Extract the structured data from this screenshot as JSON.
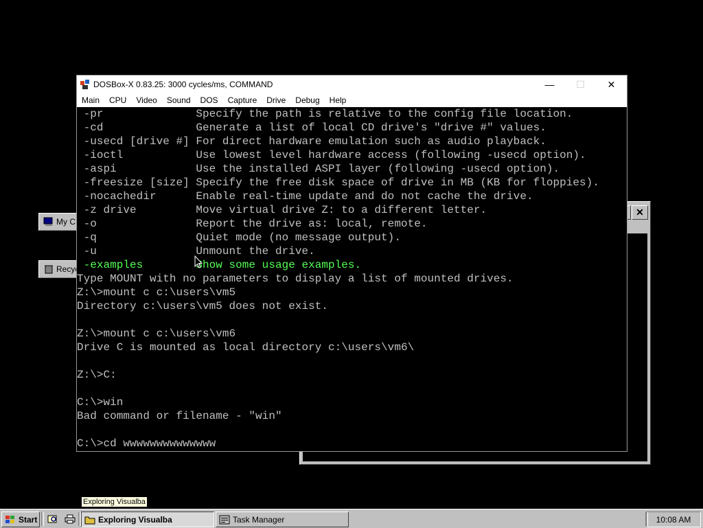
{
  "desktop": {
    "icons": [
      {
        "label": "My C"
      },
      {
        "label": "Recyc"
      }
    ]
  },
  "bg_window": {
    "close_glyph": "✕"
  },
  "dosbox": {
    "title": "DOSBox-X 0.83.25: 3000 cycles/ms, COMMAND",
    "controls": {
      "minimize": "—",
      "maximize": "☐",
      "close": "✕"
    },
    "menu": [
      "Main",
      "CPU",
      "Video",
      "Sound",
      "DOS",
      "Capture",
      "Drive",
      "Debug",
      "Help"
    ],
    "console_lines": [
      {
        "text": " -pr              Specify the path is relative to the config file location.",
        "color": "normal"
      },
      {
        "text": " -cd              Generate a list of local CD drive's \"drive #\" values.",
        "color": "normal"
      },
      {
        "text": " -usecd [drive #] For direct hardware emulation such as audio playback.",
        "color": "normal"
      },
      {
        "text": " -ioctl           Use lowest level hardware access (following -usecd option).",
        "color": "normal"
      },
      {
        "text": " -aspi            Use the installed ASPI layer (following -usecd option).",
        "color": "normal"
      },
      {
        "text": " -freesize [size] Specify the free disk space of drive in MB (KB for floppies).",
        "color": "normal"
      },
      {
        "text": " -nocachedir      Enable real-time update and do not cache the drive.",
        "color": "normal"
      },
      {
        "text": " -z drive         Move virtual drive Z: to a different letter.",
        "color": "normal"
      },
      {
        "text": " -o               Report the drive as: local, remote.",
        "color": "normal"
      },
      {
        "text": " -q               Quiet mode (no message output).",
        "color": "normal"
      },
      {
        "text": " -u               Unmount the drive.",
        "color": "normal"
      },
      {
        "text": " -examples        Show some usage examples.",
        "color": "green"
      },
      {
        "text": "Type MOUNT with no parameters to display a list of mounted drives.",
        "color": "normal"
      },
      {
        "text": "Z:\\>mount c c:\\users\\vm5",
        "color": "normal"
      },
      {
        "text": "Directory c:\\users\\vm5 does not exist.",
        "color": "normal"
      },
      {
        "text": "",
        "color": "normal"
      },
      {
        "text": "Z:\\>mount c c:\\users\\vm6",
        "color": "normal"
      },
      {
        "text": "Drive C is mounted as local directory c:\\users\\vm6\\",
        "color": "normal"
      },
      {
        "text": "",
        "color": "normal"
      },
      {
        "text": "Z:\\>C:",
        "color": "normal"
      },
      {
        "text": "",
        "color": "normal"
      },
      {
        "text": "C:\\>win",
        "color": "normal"
      },
      {
        "text": "Bad command or filename - \"win\"",
        "color": "normal"
      },
      {
        "text": "",
        "color": "normal"
      },
      {
        "text": "C:\\>cd wwwwwwwwwwwwww",
        "color": "normal"
      }
    ]
  },
  "tooltip": {
    "text": "Exploring Visualba"
  },
  "taskbar": {
    "start_label": "Start",
    "tasks": [
      {
        "label": "Exploring Visualba",
        "active": true
      },
      {
        "label": "Task Manager",
        "active": false
      }
    ],
    "clock": "10:08 AM"
  },
  "colors": {
    "console_bg": "#000000",
    "console_text": "#c0c0c0",
    "console_highlight": "#55ff55",
    "taskbar": "#c0c0c0"
  }
}
